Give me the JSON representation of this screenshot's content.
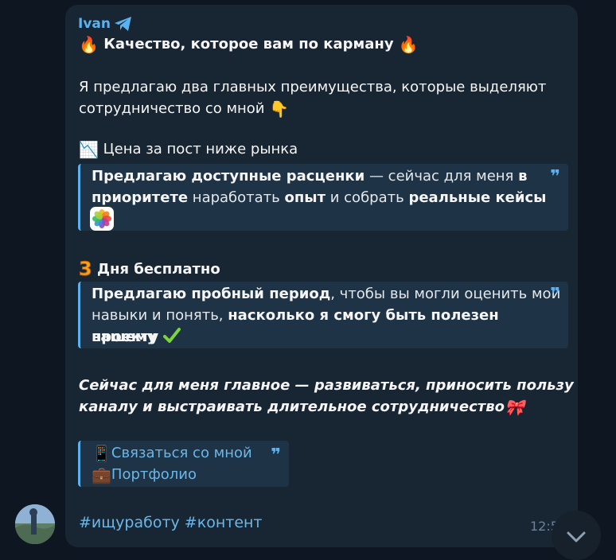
{
  "message": {
    "sender": "Ivan",
    "headline": "Качество, которое вам по карману",
    "intro_line1": "Я предлагаю два главных преимущества, которые выделяют",
    "intro_line2": "сотрудничество со мной",
    "section1_title": "Цена за пост ниже рынка",
    "quote1": {
      "p1": "Предлагаю доступные расценки",
      "p2": " — сейчас для меня ",
      "p3": "в",
      "p4": "приоритете",
      "p5": " наработать ",
      "p6": "опыт",
      "p7": " и собрать ",
      "p8": "реальные кейсы"
    },
    "section2_title": "Дня бесплатно",
    "quote2": {
      "p1": "Предлагаю пробный период",
      "p2": ", чтобы вы могли оценить мои",
      "p3": "навыки и понять, ",
      "p4": "насколько я смогу быть полезен вашему",
      "p5": "проекту"
    },
    "italic_line1": "Сейчас для меня главное — развиваться, приносить пользу",
    "italic_line2": "каналу и выстраивать длительное сотрудничество",
    "link_contact": "Связаться со мной",
    "link_portfolio": "Портфолио",
    "hashtags": "#ищуработу #контент",
    "time": "12:5"
  },
  "colors": {
    "background": "#0e1621",
    "bubble": "#182533",
    "accent": "#5ab3f0",
    "link": "#6ab7e8"
  },
  "icons": [
    "telegram-plane-icon",
    "fire-icon",
    "point-down-icon",
    "chart-icon",
    "photos-app-icon",
    "keycap-3-icon",
    "check-icon",
    "bow-icon",
    "phone-icon",
    "briefcase-icon",
    "quote-icon",
    "chevron-down-icon"
  ]
}
